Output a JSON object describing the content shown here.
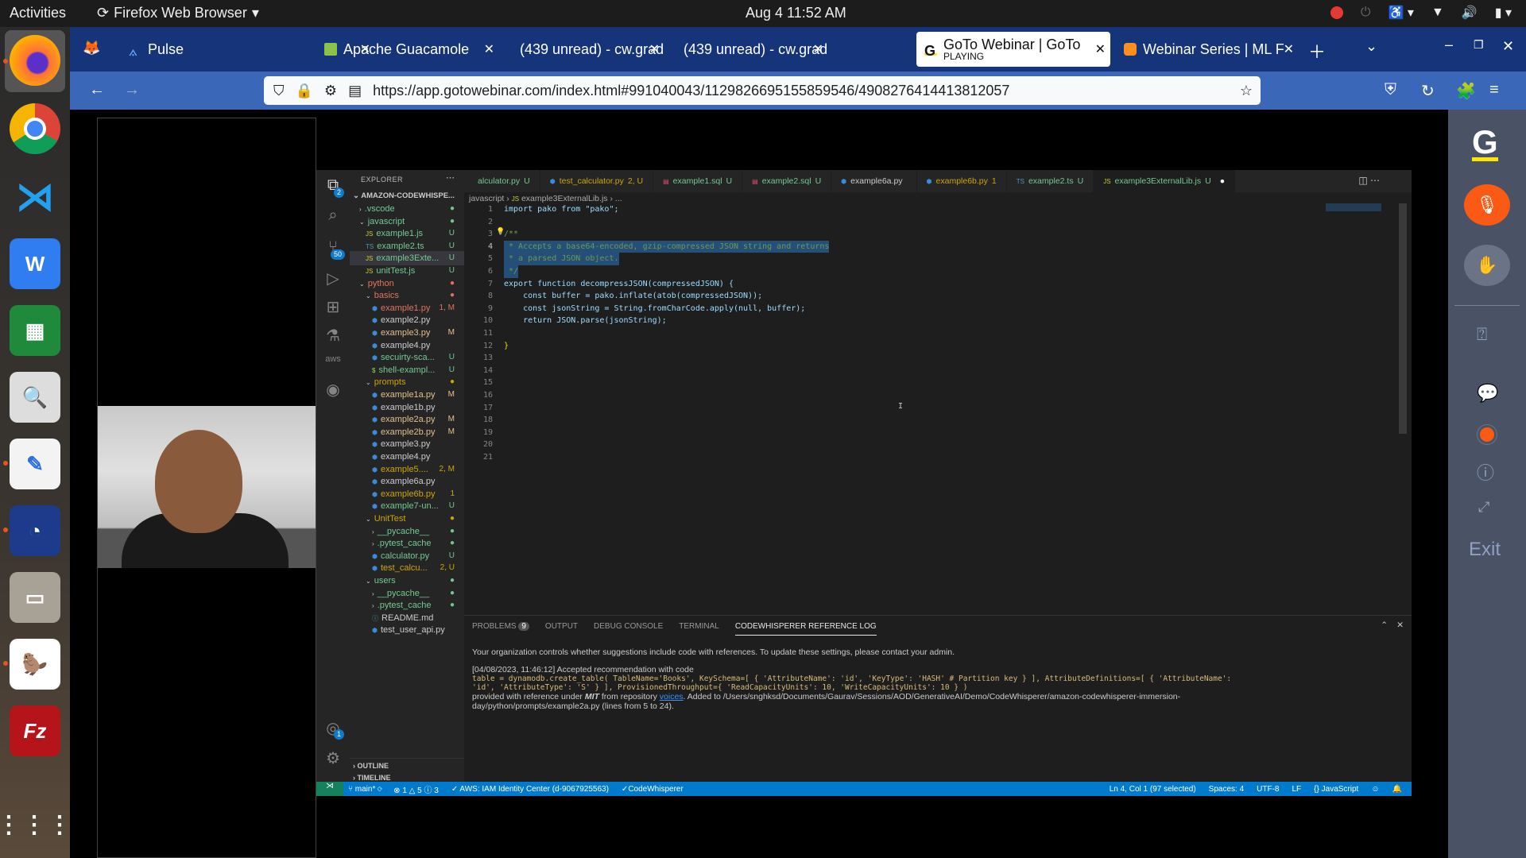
{
  "topbar": {
    "activities": "Activities",
    "app_name": "Firefox Web Browser",
    "clock": "Aug 4  11:52 AM"
  },
  "dock": {
    "apps": [
      "Firefox",
      "Google Chrome",
      "Visual Studio Code",
      "WPS Writer",
      "LibreOffice Calc",
      "Image Viewer",
      "Text Editor",
      "Mattermost",
      "Files",
      "DBeaver CE",
      "FileZilla"
    ],
    "show_apps_label": "Show Applications"
  },
  "browser": {
    "tabs": [
      {
        "title": "Pulse",
        "favicon": "pulse-icon"
      },
      {
        "title": "Apache Guacamole",
        "favicon": "guacamole-icon"
      },
      {
        "title": "(439 unread) - cw.grad",
        "favicon": "mail-icon"
      },
      {
        "title": "(439 unread) - cw.grad",
        "favicon": "mail-icon"
      },
      {
        "title": "GoTo Webinar | GoTo",
        "subtitle": "PLAYING",
        "favicon": "goto-icon",
        "active": true
      },
      {
        "title": "Webinar Series | ML F",
        "favicon": "webinar-icon"
      }
    ],
    "url": "https://app.gotowebinar.com/index.html#991040043/1129826695155859546/4908276414413812057"
  },
  "goto_sidebar": {
    "exit_label": "Exit",
    "buttons": [
      "mute-mic",
      "raise-hand",
      "questions",
      "chat",
      "record-status",
      "info",
      "fullscreen"
    ]
  },
  "vscode": {
    "explorer_header": "EXPLORER",
    "root": "AMAZON-CODEWHISPE...",
    "activity_badges": {
      "explorer": "2",
      "scm": "50",
      "accounts": "1"
    },
    "tree": [
      {
        "label": ".vscode",
        "depth": 1,
        "type": "folder-closed",
        "status": "●",
        "color": "#73c991"
      },
      {
        "label": "javascript",
        "depth": 1,
        "type": "folder-open",
        "status": "●",
        "color": "#73c991"
      },
      {
        "label": "example1.js",
        "depth": 2,
        "type": "js",
        "status": "U",
        "color": "#73c991"
      },
      {
        "label": "example2.ts",
        "depth": 2,
        "type": "ts",
        "status": "U",
        "color": "#73c991"
      },
      {
        "label": "example3Exte...",
        "depth": 2,
        "type": "js",
        "status": "U",
        "color": "#73c991",
        "selected": true
      },
      {
        "label": "unitTest.js",
        "depth": 2,
        "type": "js",
        "status": "U",
        "color": "#73c991"
      },
      {
        "label": "python",
        "depth": 1,
        "type": "folder-open",
        "status": "●",
        "color": "#e2735c"
      },
      {
        "label": "basics",
        "depth": 2,
        "type": "folder-open",
        "status": "●",
        "color": "#e2735c"
      },
      {
        "label": "example1.py",
        "depth": 3,
        "type": "py",
        "status": "1, M",
        "color": "#e2735c"
      },
      {
        "label": "example2.py",
        "depth": 3,
        "type": "py",
        "status": "",
        "color": "#cccccc"
      },
      {
        "label": "example3.py",
        "depth": 3,
        "type": "py",
        "status": "M",
        "color": "#e2c08d"
      },
      {
        "label": "example4.py",
        "depth": 3,
        "type": "py",
        "status": "",
        "color": "#cccccc"
      },
      {
        "label": "secuirty-sca...",
        "depth": 3,
        "type": "py",
        "status": "U",
        "color": "#73c991"
      },
      {
        "label": "shell-exampl...",
        "depth": 3,
        "type": "sh",
        "status": "U",
        "color": "#73c991"
      },
      {
        "label": "prompts",
        "depth": 2,
        "type": "folder-open",
        "status": "●",
        "color": "#cca700"
      },
      {
        "label": "example1a.py",
        "depth": 3,
        "type": "py",
        "status": "M",
        "color": "#e2c08d"
      },
      {
        "label": "example1b.py",
        "depth": 3,
        "type": "py",
        "status": "",
        "color": "#cccccc"
      },
      {
        "label": "example2a.py",
        "depth": 3,
        "type": "py",
        "status": "M",
        "color": "#e2c08d"
      },
      {
        "label": "example2b.py",
        "depth": 3,
        "type": "py",
        "status": "M",
        "color": "#e2c08d"
      },
      {
        "label": "example3.py",
        "depth": 3,
        "type": "py",
        "status": "",
        "color": "#cccccc"
      },
      {
        "label": "example4.py",
        "depth": 3,
        "type": "py",
        "status": "",
        "color": "#cccccc"
      },
      {
        "label": "example5....",
        "depth": 3,
        "type": "py",
        "status": "2, M",
        "color": "#cca700"
      },
      {
        "label": "example6a.py",
        "depth": 3,
        "type": "py",
        "status": "",
        "color": "#cccccc"
      },
      {
        "label": "example6b.py",
        "depth": 3,
        "type": "py",
        "status": "1",
        "color": "#cca700"
      },
      {
        "label": "example7-un...",
        "depth": 3,
        "type": "py",
        "status": "U",
        "color": "#73c991"
      },
      {
        "label": "UnitTest",
        "depth": 2,
        "type": "folder-open",
        "status": "●",
        "color": "#cca700"
      },
      {
        "label": "__pycache__",
        "depth": 3,
        "type": "folder-closed",
        "status": "●",
        "color": "#73c991"
      },
      {
        "label": ".pytest_cache",
        "depth": 3,
        "type": "folder-closed",
        "status": "●",
        "color": "#73c991"
      },
      {
        "label": "calculator.py",
        "depth": 3,
        "type": "py",
        "status": "U",
        "color": "#73c991"
      },
      {
        "label": "test_calcu...",
        "depth": 3,
        "type": "py",
        "status": "2, U",
        "color": "#cca700"
      },
      {
        "label": "users",
        "depth": 2,
        "type": "folder-open",
        "status": "●",
        "color": "#73c991"
      },
      {
        "label": "__pycache__",
        "depth": 3,
        "type": "folder-closed",
        "status": "●",
        "color": "#73c991"
      },
      {
        "label": ".pytest_cache",
        "depth": 3,
        "type": "folder-closed",
        "status": "●",
        "color": "#73c991"
      },
      {
        "label": "README.md",
        "depth": 3,
        "type": "md",
        "status": "",
        "color": "#cccccc"
      },
      {
        "label": "test_user_api.py",
        "depth": 3,
        "type": "py",
        "status": "",
        "color": "#cccccc"
      }
    ],
    "sections": [
      "OUTLINE",
      "TIMELINE"
    ],
    "editor_tabs": [
      {
        "label": "alculator.py",
        "status": "U",
        "type": "py",
        "color": "#73c991"
      },
      {
        "label": "test_calculator.py",
        "status": "2, U",
        "type": "py",
        "color": "#cca700"
      },
      {
        "label": "example1.sql",
        "status": "U",
        "type": "sql",
        "color": "#73c991"
      },
      {
        "label": "example2.sql",
        "status": "U",
        "type": "sql",
        "color": "#73c991"
      },
      {
        "label": "example6a.py",
        "status": "",
        "type": "py",
        "color": "#cccccc"
      },
      {
        "label": "example6b.py",
        "status": "1",
        "type": "py",
        "color": "#cca700"
      },
      {
        "label": "example2.ts",
        "status": "U",
        "type": "ts",
        "color": "#73c991"
      },
      {
        "label": "example3ExternalLib.js",
        "status": "U",
        "type": "js",
        "color": "#73c991",
        "active": true,
        "dirty": true
      }
    ],
    "breadcrumb": [
      "javascript",
      "example3ExternalLib.js",
      "..."
    ],
    "code_lines": [
      "import pako from \"pako\";",
      "",
      "/**",
      " * Accepts a base64-encoded, gzip-compressed JSON string and returns",
      " * a parsed JSON object.",
      " */",
      "export function decompressJSON(compressedJSON) {",
      "    const buffer = pako.inflate(atob(compressedJSON));",
      "    const jsonString = String.fromCharCode.apply(null, buffer);",
      "    return JSON.parse(jsonString);",
      "",
      "}",
      "",
      "",
      "",
      "",
      "",
      "",
      "",
      "",
      ""
    ],
    "panel": {
      "tabs": [
        "PROBLEMS",
        "OUTPUT",
        "DEBUG CONSOLE",
        "TERMINAL",
        "CODEWHISPERER REFERENCE LOG"
      ],
      "problems_count": "9",
      "notice": "Your organization controls whether suggestions include code with references. To update these settings, please contact your admin.",
      "log_header": "[04/08/2023, 11:46:12] Accepted recommendation with code",
      "log_code_1": "table = dynamodb.create_table( TableName='Books', KeySchema=[ { 'AttributeName': 'id', 'KeyType': 'HASH' # Partition key } ], AttributeDefinitions=[ { 'AttributeName':",
      "log_code_2": "'id', 'AttributeType': 'S' } ], ProvisionedThroughput={ 'ReadCapacityUnits': 10, 'WriteCapacityUnits': 10 } )",
      "log_ref_pre": "provided with reference under ",
      "log_license": "MIT",
      "log_ref_mid": " from repository ",
      "log_repo": "voices",
      "log_ref_post": ". Added to /Users/snghksd/Documents/Gaurav/Sessions/AOD/GenerativeAI/Demo/CodeWhisperer/amazon-codewhisperer-immersion-",
      "log_ref_line2": "day/python/prompts/example2a.py (lines from 5 to 24)."
    },
    "status": {
      "branch": "main*",
      "errors": "1",
      "warnings": "5",
      "infos": "3",
      "aws": "AWS: IAM Identity Center (d-9067925563)",
      "codewhisperer": "CodeWhisperer",
      "position": "Ln 4, Col 1 (97 selected)",
      "spaces": "Spaces: 4",
      "encoding": "UTF-8",
      "eol": "LF",
      "language": "JavaScript"
    }
  }
}
